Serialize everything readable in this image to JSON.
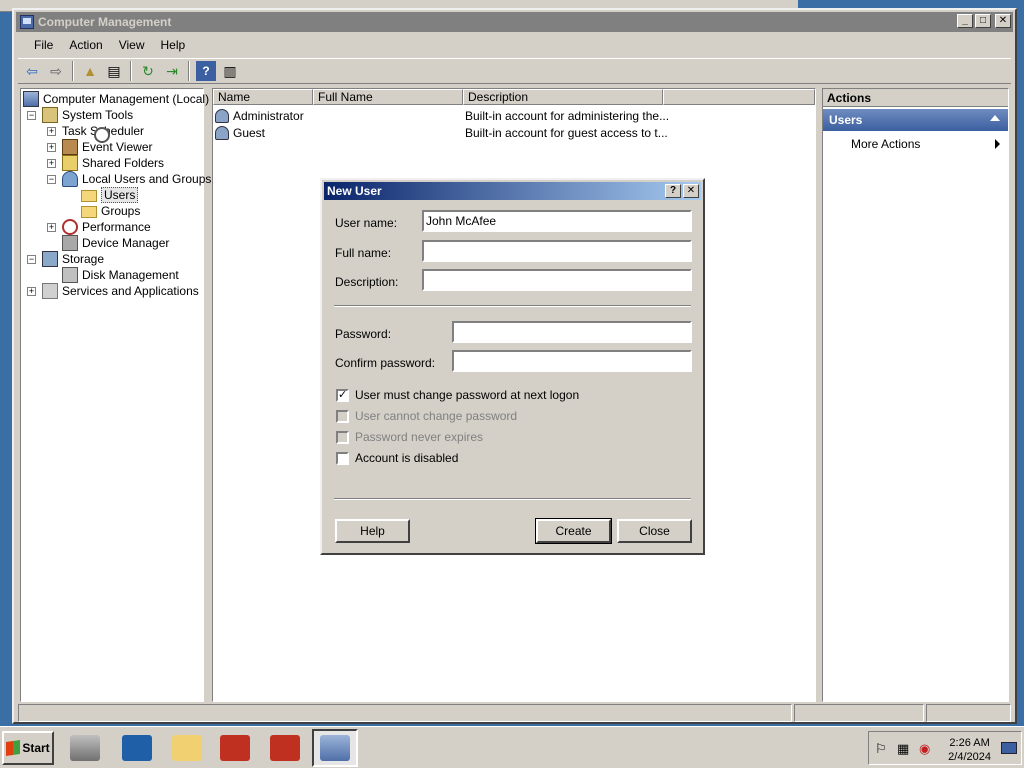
{
  "window": {
    "title": "Computer Management",
    "menu": [
      "File",
      "Action",
      "View",
      "Help"
    ]
  },
  "tree": {
    "root": "Computer Management (Local)",
    "system_tools": "System Tools",
    "task_scheduler": "Task Scheduler",
    "event_viewer": "Event Viewer",
    "shared_folders": "Shared Folders",
    "local_users": "Local Users and Groups",
    "users": "Users",
    "groups": "Groups",
    "performance": "Performance",
    "device_manager": "Device Manager",
    "storage": "Storage",
    "disk_management": "Disk Management",
    "services": "Services and Applications"
  },
  "list": {
    "columns": [
      "Name",
      "Full Name",
      "Description"
    ],
    "rows": [
      {
        "name": "Administrator",
        "full_name": "",
        "description": "Built-in account for administering the..."
      },
      {
        "name": "Guest",
        "full_name": "",
        "description": "Built-in account for guest access to t..."
      }
    ]
  },
  "actions": {
    "header": "Actions",
    "group": "Users",
    "more": "More Actions"
  },
  "dialog": {
    "title": "New User",
    "help_glyph": "?",
    "close_glyph": "✕",
    "user_name_label": "User name:",
    "user_name_value": "John McAfee",
    "full_name_label": "Full name:",
    "full_name_value": "",
    "description_label": "Description:",
    "description_value": "",
    "password_label": "Password:",
    "confirm_label": "Confirm password:",
    "chk_must_change": "User must change password at next logon",
    "chk_must_change_checked": true,
    "chk_cannot_change": "User cannot change password",
    "chk_never_expires": "Password never expires",
    "chk_disabled": "Account is disabled",
    "btn_help": "Help",
    "btn_create": "Create",
    "btn_close": "Close"
  },
  "taskbar": {
    "start": "Start",
    "time": "2:26 AM",
    "date": "2/4/2024"
  }
}
